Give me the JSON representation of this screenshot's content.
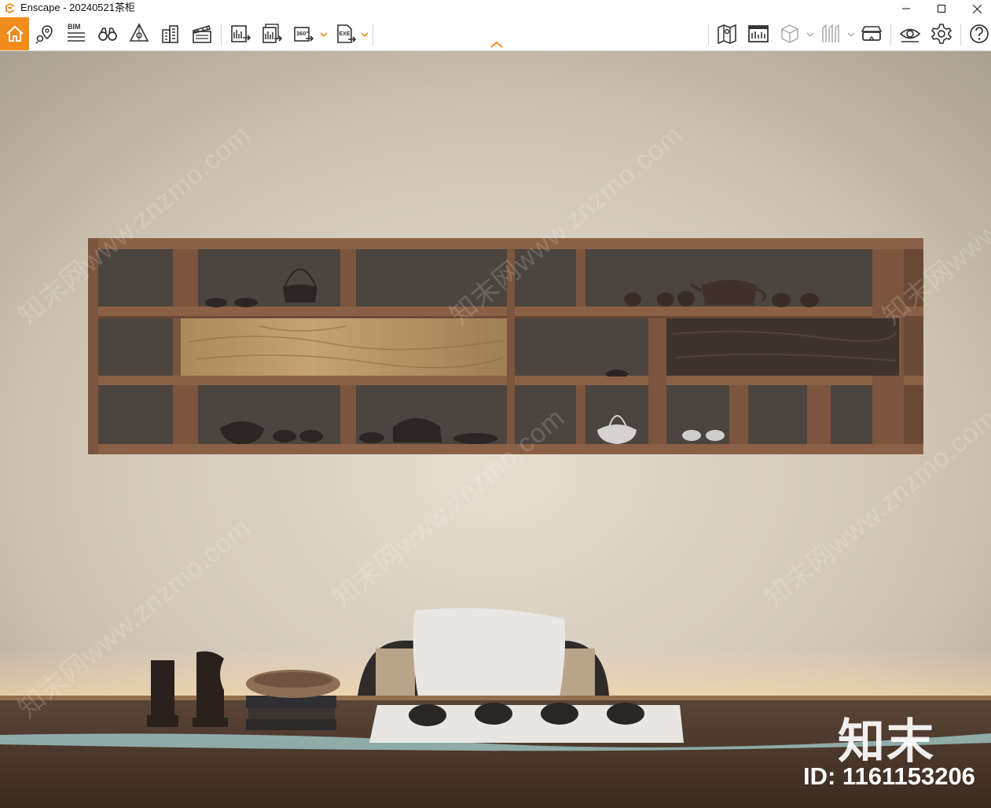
{
  "window": {
    "app_name": "Enscape",
    "title": "Enscape - 20240521茶柜"
  },
  "toolbar": {
    "left_group_1": [
      "home-icon",
      "location-pin-icon",
      "bim-icon",
      "binoculars-icon",
      "perspective-icon",
      "buildings-icon",
      "clapperboard-icon"
    ],
    "left_group_2": [
      "export-image-icon",
      "batch-export-icon",
      "panorama-360-icon",
      "export-exe-icon"
    ],
    "right_group": [
      "map-icon",
      "asset-library-icon",
      "cube-view-icon",
      "section-icon",
      "vr-headset-icon",
      "visual-settings-icon",
      "settings-icon",
      "help-icon"
    ],
    "bim_label": "BIM",
    "pano_label": "360°",
    "exe_label": "EXE",
    "accent": "#f28c1c"
  },
  "viewport": {
    "watermark_text": "知末网www.znzmo.com",
    "brand_text": "知末",
    "id_text": "ID: 1161153206"
  }
}
